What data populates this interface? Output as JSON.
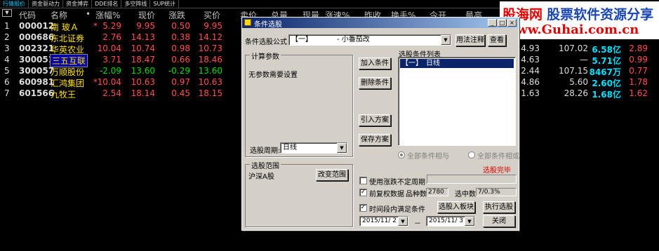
{
  "tabs": [
    "行情报价",
    "资金驱动力",
    "资金博弈",
    "DDE排名",
    "多空阵线",
    "SUP统计"
  ],
  "header": {
    "sort_symbol": "▼",
    "cols": [
      "代码",
      "名称",
      "•",
      "涨幅%",
      "现价",
      "涨跌",
      "买价",
      "卖价",
      "总量",
      "现量",
      "涨速%",
      "昨收",
      "换手%",
      "今开",
      "最高"
    ]
  },
  "rows": [
    {
      "idx": "1",
      "code": "000012",
      "name": "南 玻Ａ",
      "mark": "*",
      "chg": "5.29",
      "price": "9.95",
      "diff": "0.50",
      "buy": "9.95",
      "r1": "",
      "r2": "",
      "r3": "",
      "r4": ""
    },
    {
      "idx": "2",
      "code": "000686",
      "name": "东北证券",
      "mark": "",
      "chg": "2.76",
      "price": "14.13",
      "diff": "0.38",
      "buy": "14.12",
      "r1": "",
      "r2": "",
      "r3": "",
      "r4": ""
    },
    {
      "idx": "3",
      "code": "002321",
      "name": "华英农业",
      "mark": "",
      "chg": "10.04",
      "price": "10.74",
      "diff": "0.98",
      "buy": "10.73",
      "r1": "14.93",
      "r2": "107.02",
      "r3": "6.58亿",
      "r4": "2.89"
    },
    {
      "idx": "4",
      "code": "300051",
      "name": "三五互联",
      "mark": "",
      "chg": "3.71",
      "price": "18.47",
      "diff": "0.66",
      "buy": "18.46",
      "r1": "14.63",
      "r2": "—",
      "r3": "5.71亿",
      "r4": "0.99"
    },
    {
      "idx": "5",
      "code": "300057",
      "name": "万顺股份",
      "mark": "",
      "chg": "-2.09",
      "price": "13.60",
      "diff": "-0.29",
      "buy": "13.60",
      "r1": "2.44",
      "r2": "107.15",
      "r3": "8467万",
      "r4": "0.77"
    },
    {
      "idx": "6",
      "code": "600981",
      "name": "汇鸿集团",
      "mark": "*",
      "chg": "10.04",
      "price": "10.63",
      "diff": "0.97",
      "buy": "10.63",
      "r1": "4.86",
      "r2": "5.60",
      "r3": "2.60亿",
      "r4": "1.78"
    },
    {
      "idx": "7",
      "code": "601566",
      "name": "九牧王",
      "mark": "",
      "chg": "2.54",
      "price": "18.14",
      "diff": "0.45",
      "buy": "18.15",
      "r1": "1.63",
      "r2": "28.26",
      "r3": "1.68亿",
      "r4": "1.62"
    }
  ],
  "watermark": {
    "brand": "股海网",
    "slogan": "股票软件资源分享",
    "url": "Www.Guhai.com.cn"
  },
  "dialog": {
    "title": "条件选股",
    "formula_label": "条件选股公式",
    "formula_value": "【一】　　　　- 小番茄改",
    "btn_usage": "用法注释",
    "btn_view": "查看",
    "params_group": "计算参数",
    "params_text": "无参数需要设置",
    "btn_add": "加入条件",
    "btn_delete": "删除条件",
    "btn_import": "引入方案",
    "btn_save": "保存方案",
    "list_title": "选股条件列表",
    "list_item": "【一】　日线",
    "radio_and": "全部条件相与",
    "radio_or": "全部条件相或",
    "period_label": "选股周期:",
    "period_value": "日线",
    "status": "选股完毕",
    "range_group": "选股范围",
    "range_text": "沪深A股",
    "btn_change_range": "改变范围",
    "chk_uncertain": "使用涨跌不定周期",
    "chk_adjusted": "前复权数据",
    "count_label": "品种数",
    "count_value": "2780",
    "selected_label": "选中数",
    "selected_value": "7/0.3%",
    "chk_timerange": "时间段内满足条件",
    "btn_to_block": "选股入板块",
    "btn_execute": "执行选股",
    "date_from": "2015/11/ 2",
    "date_sep": "－",
    "date_to": "2015/11/ 3",
    "btn_close": "关闭"
  }
}
